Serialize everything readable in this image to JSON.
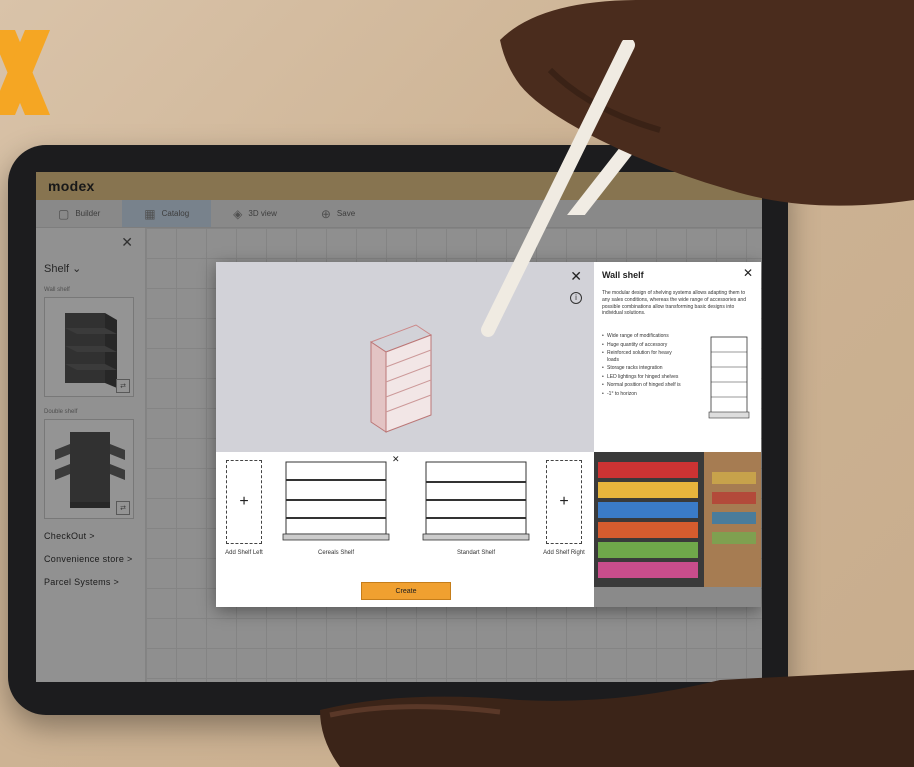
{
  "app": {
    "title": "modex"
  },
  "toolbar": {
    "items": [
      {
        "label": "Builder",
        "icon": "builder-icon"
      },
      {
        "label": "Catalog",
        "icon": "catalog-icon",
        "active": true
      },
      {
        "label": "3D view",
        "icon": "3d-view-icon"
      },
      {
        "label": "Save",
        "icon": "save-icon"
      }
    ]
  },
  "sidebar": {
    "category": "Shelf ⌄",
    "items": [
      {
        "caption": "Wall shelf"
      },
      {
        "caption": "Double shelf"
      }
    ],
    "links": [
      "CheckOut >",
      "Convenience store >",
      "Parcel Systems >"
    ]
  },
  "modal": {
    "preview": {
      "info_symbol": "i"
    },
    "details": {
      "title": "Wall shelf",
      "description": "The modular design of shelving systems allows adapting them to any sales conditions, whereas the wide range of accessories and possible combinations allow transforming basic designs into individual solutions.",
      "features": [
        "Wide range of modifications",
        "Huge quantity of accessory",
        "Reinforced solution for heavy loads",
        "Storage racks integration",
        "LED lightings for hinged shelves",
        "Normal position of hinged shelf is",
        "-1° to horizon"
      ]
    },
    "config": {
      "add_left_label": "Add Shelf Left",
      "add_right_label": "Add Shelf Right",
      "shelf1_label": "Cereals Shelf",
      "shelf2_label": "Standart Shelf",
      "create_label": "Create"
    }
  },
  "colors": {
    "header_bg": "#e9c98b",
    "accent": "#f0a030",
    "brand_orange": "#f5a623",
    "active_tab": "#cfe0f1"
  }
}
